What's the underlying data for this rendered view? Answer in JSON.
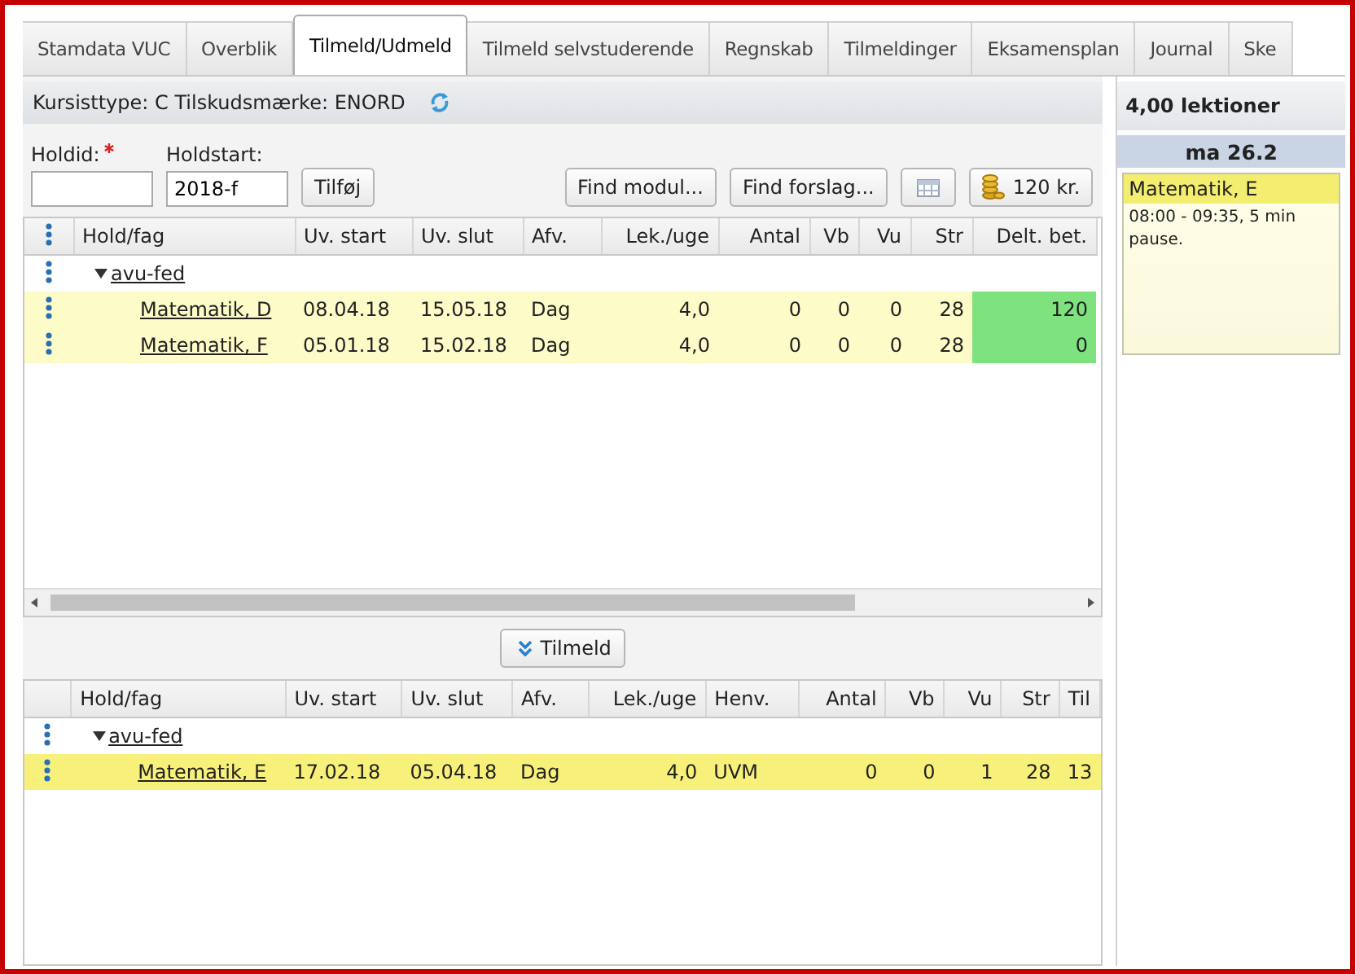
{
  "tabs": [
    {
      "label": "Stamdata VUC",
      "selected": false
    },
    {
      "label": "Overblik",
      "selected": false
    },
    {
      "label": "Tilmeld/Udmeld",
      "selected": true
    },
    {
      "label": "Tilmeld selvstuderende",
      "selected": false
    },
    {
      "label": "Regnskab",
      "selected": false
    },
    {
      "label": "Tilmeldinger",
      "selected": false
    },
    {
      "label": "Eksamensplan",
      "selected": false
    },
    {
      "label": "Journal",
      "selected": false
    },
    {
      "label": "Ske",
      "selected": false
    }
  ],
  "info_bar": {
    "text": "Kursisttype: C Tilskudsmærke: ENORD"
  },
  "form": {
    "fields": [
      {
        "label": "Holdid:",
        "required": true
      },
      {
        "label": "Holdstart:",
        "value": "2018-f"
      }
    ],
    "add_button": "Tilføj",
    "buttons": [
      {
        "kind": "text",
        "label": "Find modul..."
      },
      {
        "kind": "text",
        "label": "Find forslag..."
      },
      {
        "kind": "calendar"
      },
      {
        "kind": "coins",
        "label": "120 kr."
      }
    ]
  },
  "top_table": {
    "menu_in_header": true,
    "columns": [
      {
        "label": "Hold/fag",
        "kind": "text"
      },
      {
        "label": "Uv. start",
        "kind": "text"
      },
      {
        "label": "Uv. slut",
        "kind": "text"
      },
      {
        "label": "Afv.",
        "kind": "text"
      },
      {
        "label": "Lek./uge",
        "kind": "number"
      },
      {
        "label": "Antal",
        "kind": "number"
      },
      {
        "label": "Vb",
        "kind": "number"
      },
      {
        "label": "Vu",
        "kind": "number"
      },
      {
        "label": "Str",
        "kind": "number"
      },
      {
        "label": "Delt. bet.",
        "kind": "payment"
      }
    ],
    "groups": [
      {
        "label": "avu-fed",
        "expanded": true,
        "children": [
          {
            "cells": [
              "Matematik, D",
              "08.04.18",
              "15.05.18",
              "Dag",
              "4,0",
              "0",
              "0",
              "0",
              "28",
              "120"
            ],
            "paid": true,
            "selected": false
          },
          {
            "cells": [
              "Matematik, F",
              "05.01.18",
              "15.02.18",
              "Dag",
              "4,0",
              "0",
              "0",
              "0",
              "28",
              "0"
            ],
            "paid": true,
            "selected": false
          }
        ]
      }
    ]
  },
  "register_button": "Tilmeld",
  "bottom_table": {
    "menu_in_header": false,
    "columns": [
      {
        "label": "Hold/fag",
        "kind": "text"
      },
      {
        "label": "Uv. start",
        "kind": "text"
      },
      {
        "label": "Uv. slut",
        "kind": "text"
      },
      {
        "label": "Afv.",
        "kind": "text"
      },
      {
        "label": "Lek./uge",
        "kind": "number"
      },
      {
        "label": "Henv.",
        "kind": "text"
      },
      {
        "label": "Antal",
        "kind": "number"
      },
      {
        "label": "Vb",
        "kind": "number"
      },
      {
        "label": "Vu",
        "kind": "number"
      },
      {
        "label": "Str",
        "kind": "number"
      },
      {
        "label": "Til",
        "kind": "text"
      }
    ],
    "groups": [
      {
        "label": "avu-fed",
        "expanded": true,
        "children": [
          {
            "cells": [
              "Matematik, E",
              "17.02.18",
              "05.04.18",
              "Dag",
              "4,0",
              "UVM",
              "0",
              "0",
              "1",
              "28",
              "13"
            ],
            "selected": true
          }
        ]
      }
    ]
  },
  "sidebar": {
    "title": "4,00 lektioner",
    "day": "ma 26.2",
    "events": [
      {
        "title": "Matematik, E",
        "detail": "08:00 - 09:35, 5 min pause."
      }
    ]
  }
}
